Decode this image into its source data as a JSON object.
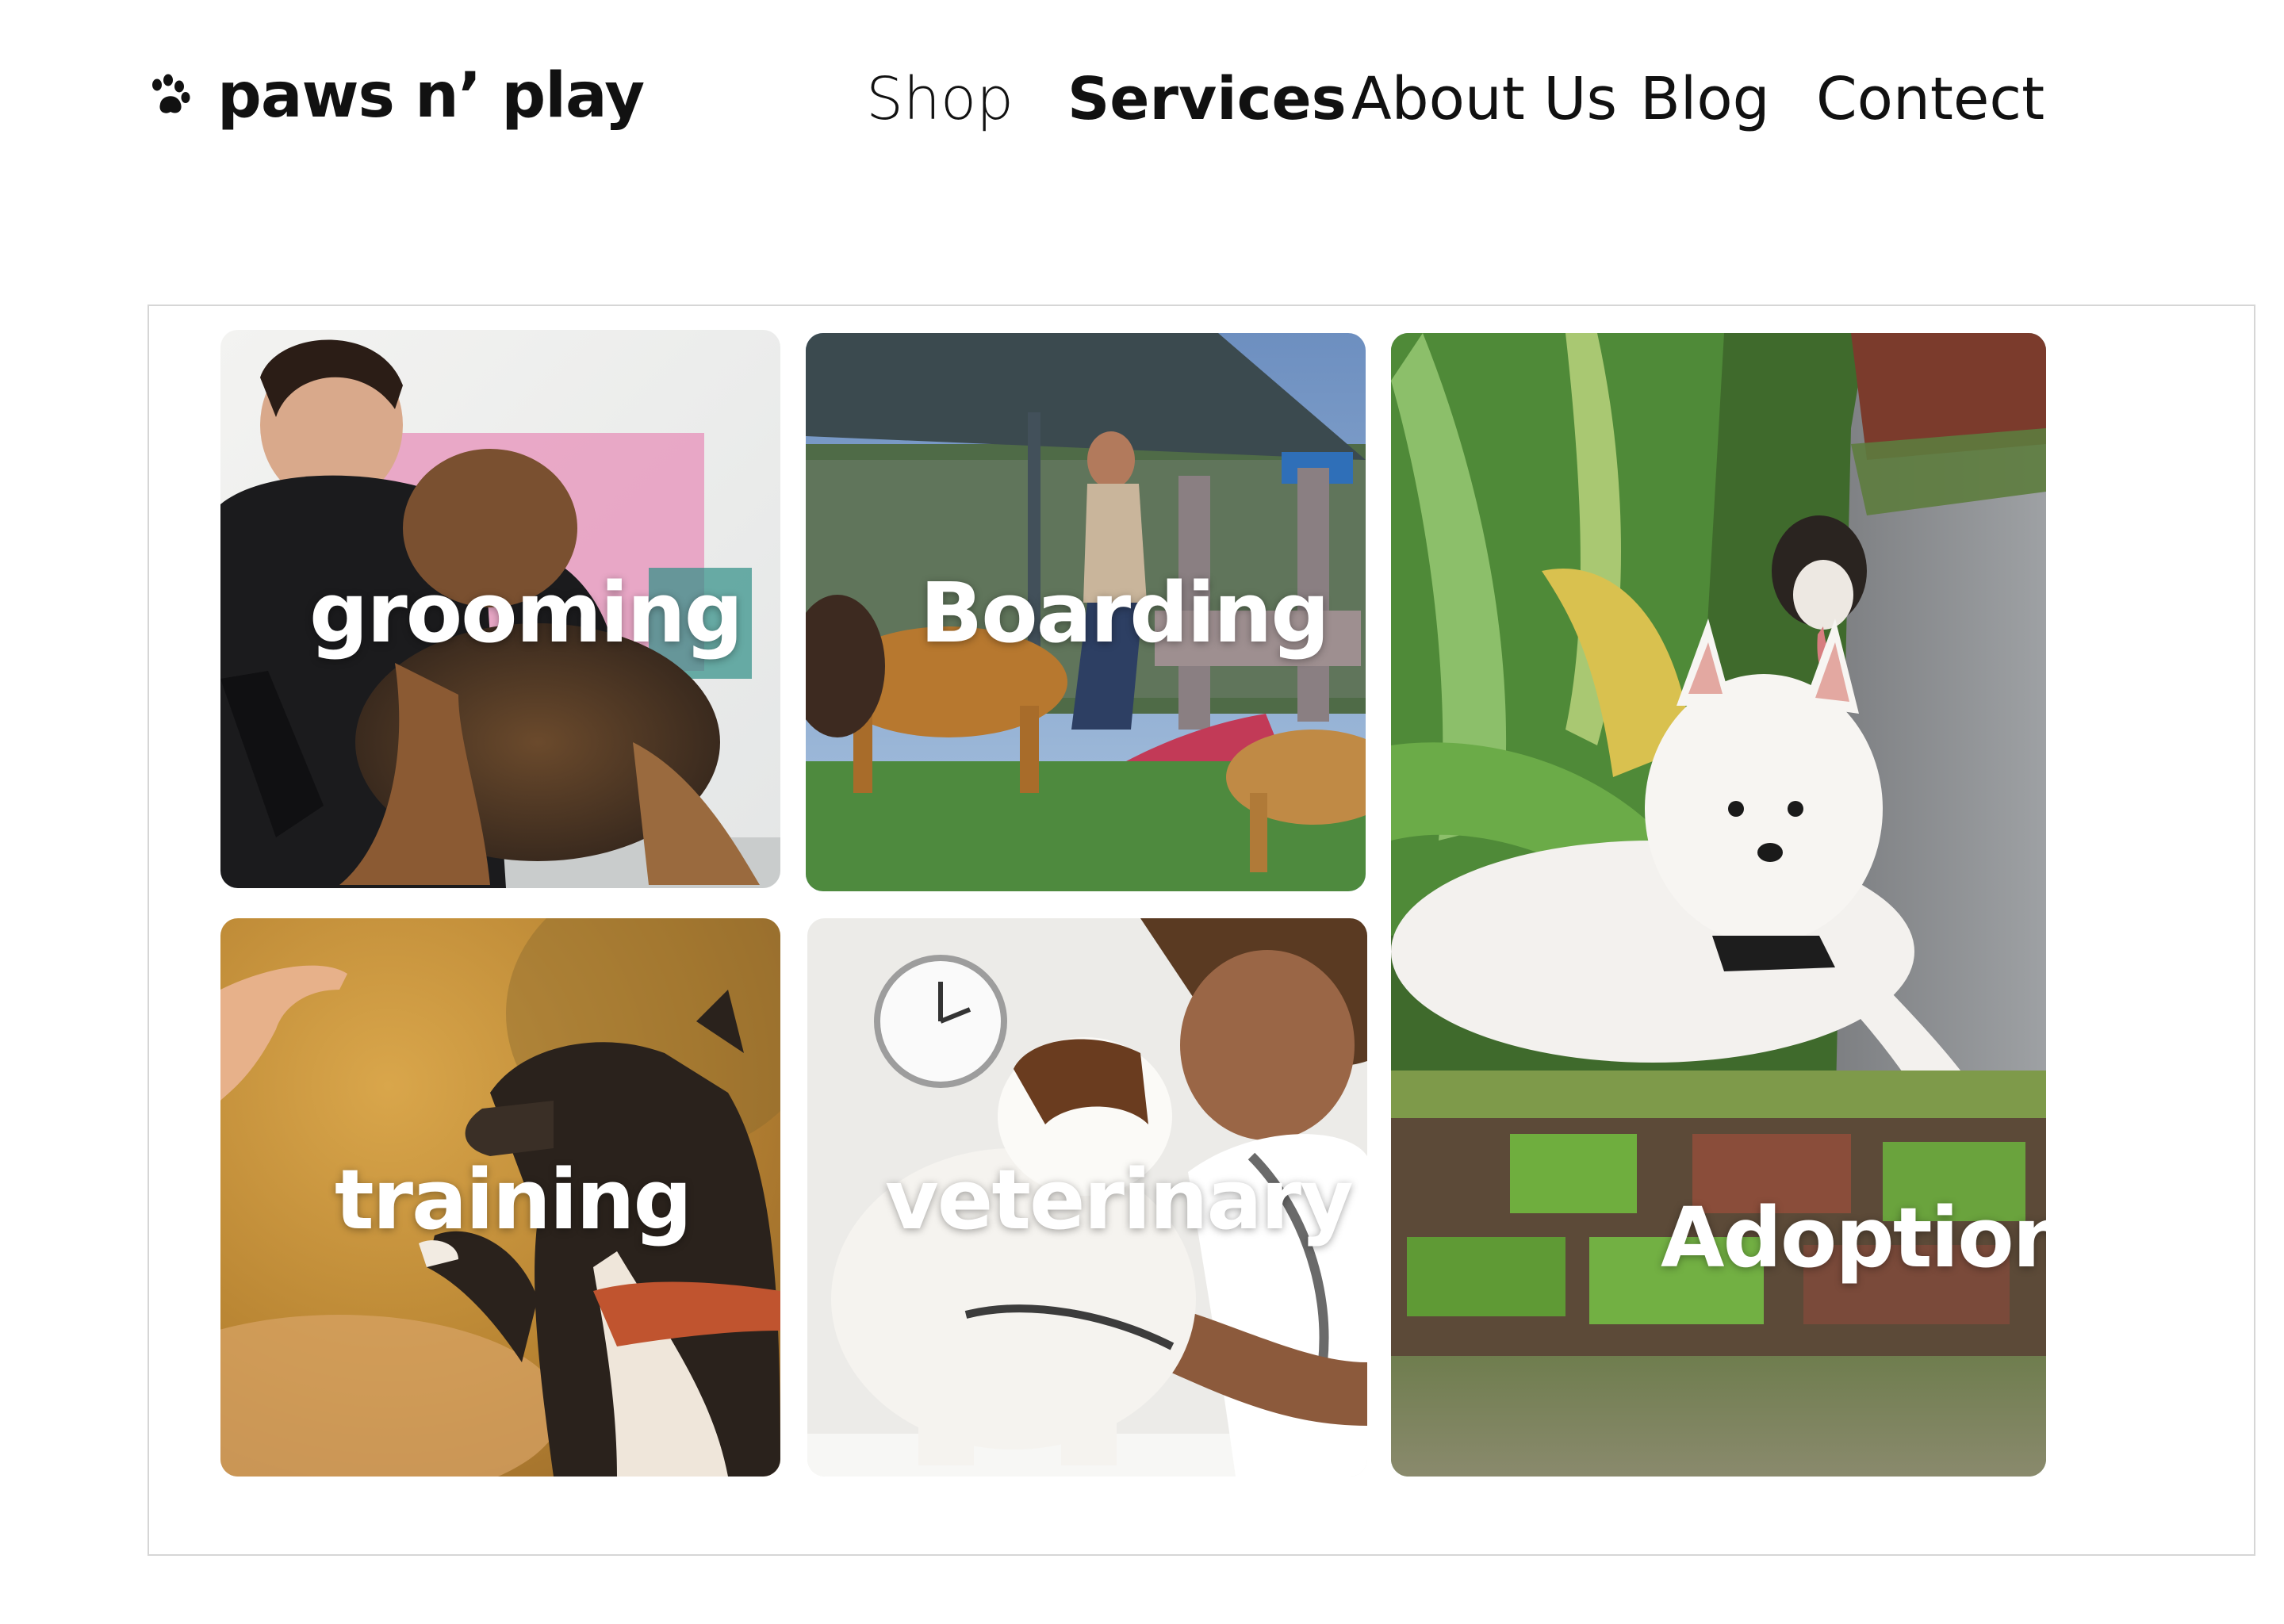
{
  "brand": {
    "name": "paws n’ play",
    "icon": "paw-icon"
  },
  "nav": {
    "items": [
      {
        "label": "Shop",
        "active": false
      },
      {
        "label": "Services",
        "active": true
      },
      {
        "label": "About Us",
        "active": false
      },
      {
        "label": "Blog",
        "active": false
      },
      {
        "label": "Contect",
        "active": false
      }
    ]
  },
  "services": {
    "cards": [
      {
        "label": "grooming"
      },
      {
        "label": "Boarding"
      },
      {
        "label": "training"
      },
      {
        "label": "veterinary"
      },
      {
        "label": "Adoption"
      }
    ]
  },
  "colors": {
    "text": "#111111",
    "card_label": "#ffffff",
    "panel_border": "#d6d6d6"
  }
}
